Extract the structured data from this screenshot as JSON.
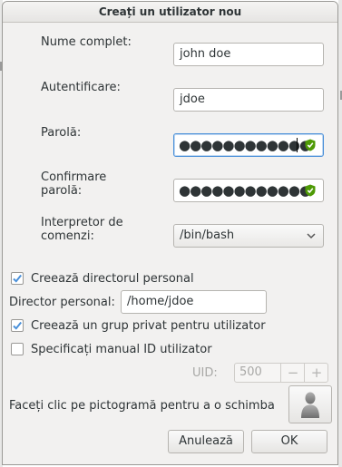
{
  "window": {
    "title": "Creați un utilizator nou"
  },
  "form": {
    "full_name_label": "Nume complet:",
    "full_name_value": "john doe",
    "login_label": "Autentificare:",
    "login_value": "jdoe",
    "password_label": "Parolă:",
    "password_mask": "●●●●●●●●●●●●",
    "confirm_label": "Confirmare\nparolă:",
    "confirm_mask": "●●●●●●●●●●●●",
    "shell_label": "Interpretor de\ncomenzi:",
    "shell_value": "/bin/bash"
  },
  "options": {
    "create_home_label": "Creează directorul personal",
    "create_home_checked": true,
    "home_dir_label": "Director personal:",
    "home_dir_value": "/home/jdoe",
    "private_group_label": "Creează un grup privat pentru utilizator",
    "private_group_checked": true,
    "manual_uid_label": "Specificați manual ID utilizator",
    "manual_uid_checked": false,
    "uid_label": "UID:",
    "uid_value": "500",
    "uid_minus": "−",
    "uid_plus": "+"
  },
  "icon_row": {
    "label": "Faceți clic pe pictogramă pentru a o schimba",
    "icon": "user-avatar-icon"
  },
  "buttons": {
    "cancel": "Anulează",
    "ok": "OK"
  },
  "colors": {
    "accent": "#4a90d9",
    "check": "#4a90d9",
    "shield": "#4e9a06"
  }
}
